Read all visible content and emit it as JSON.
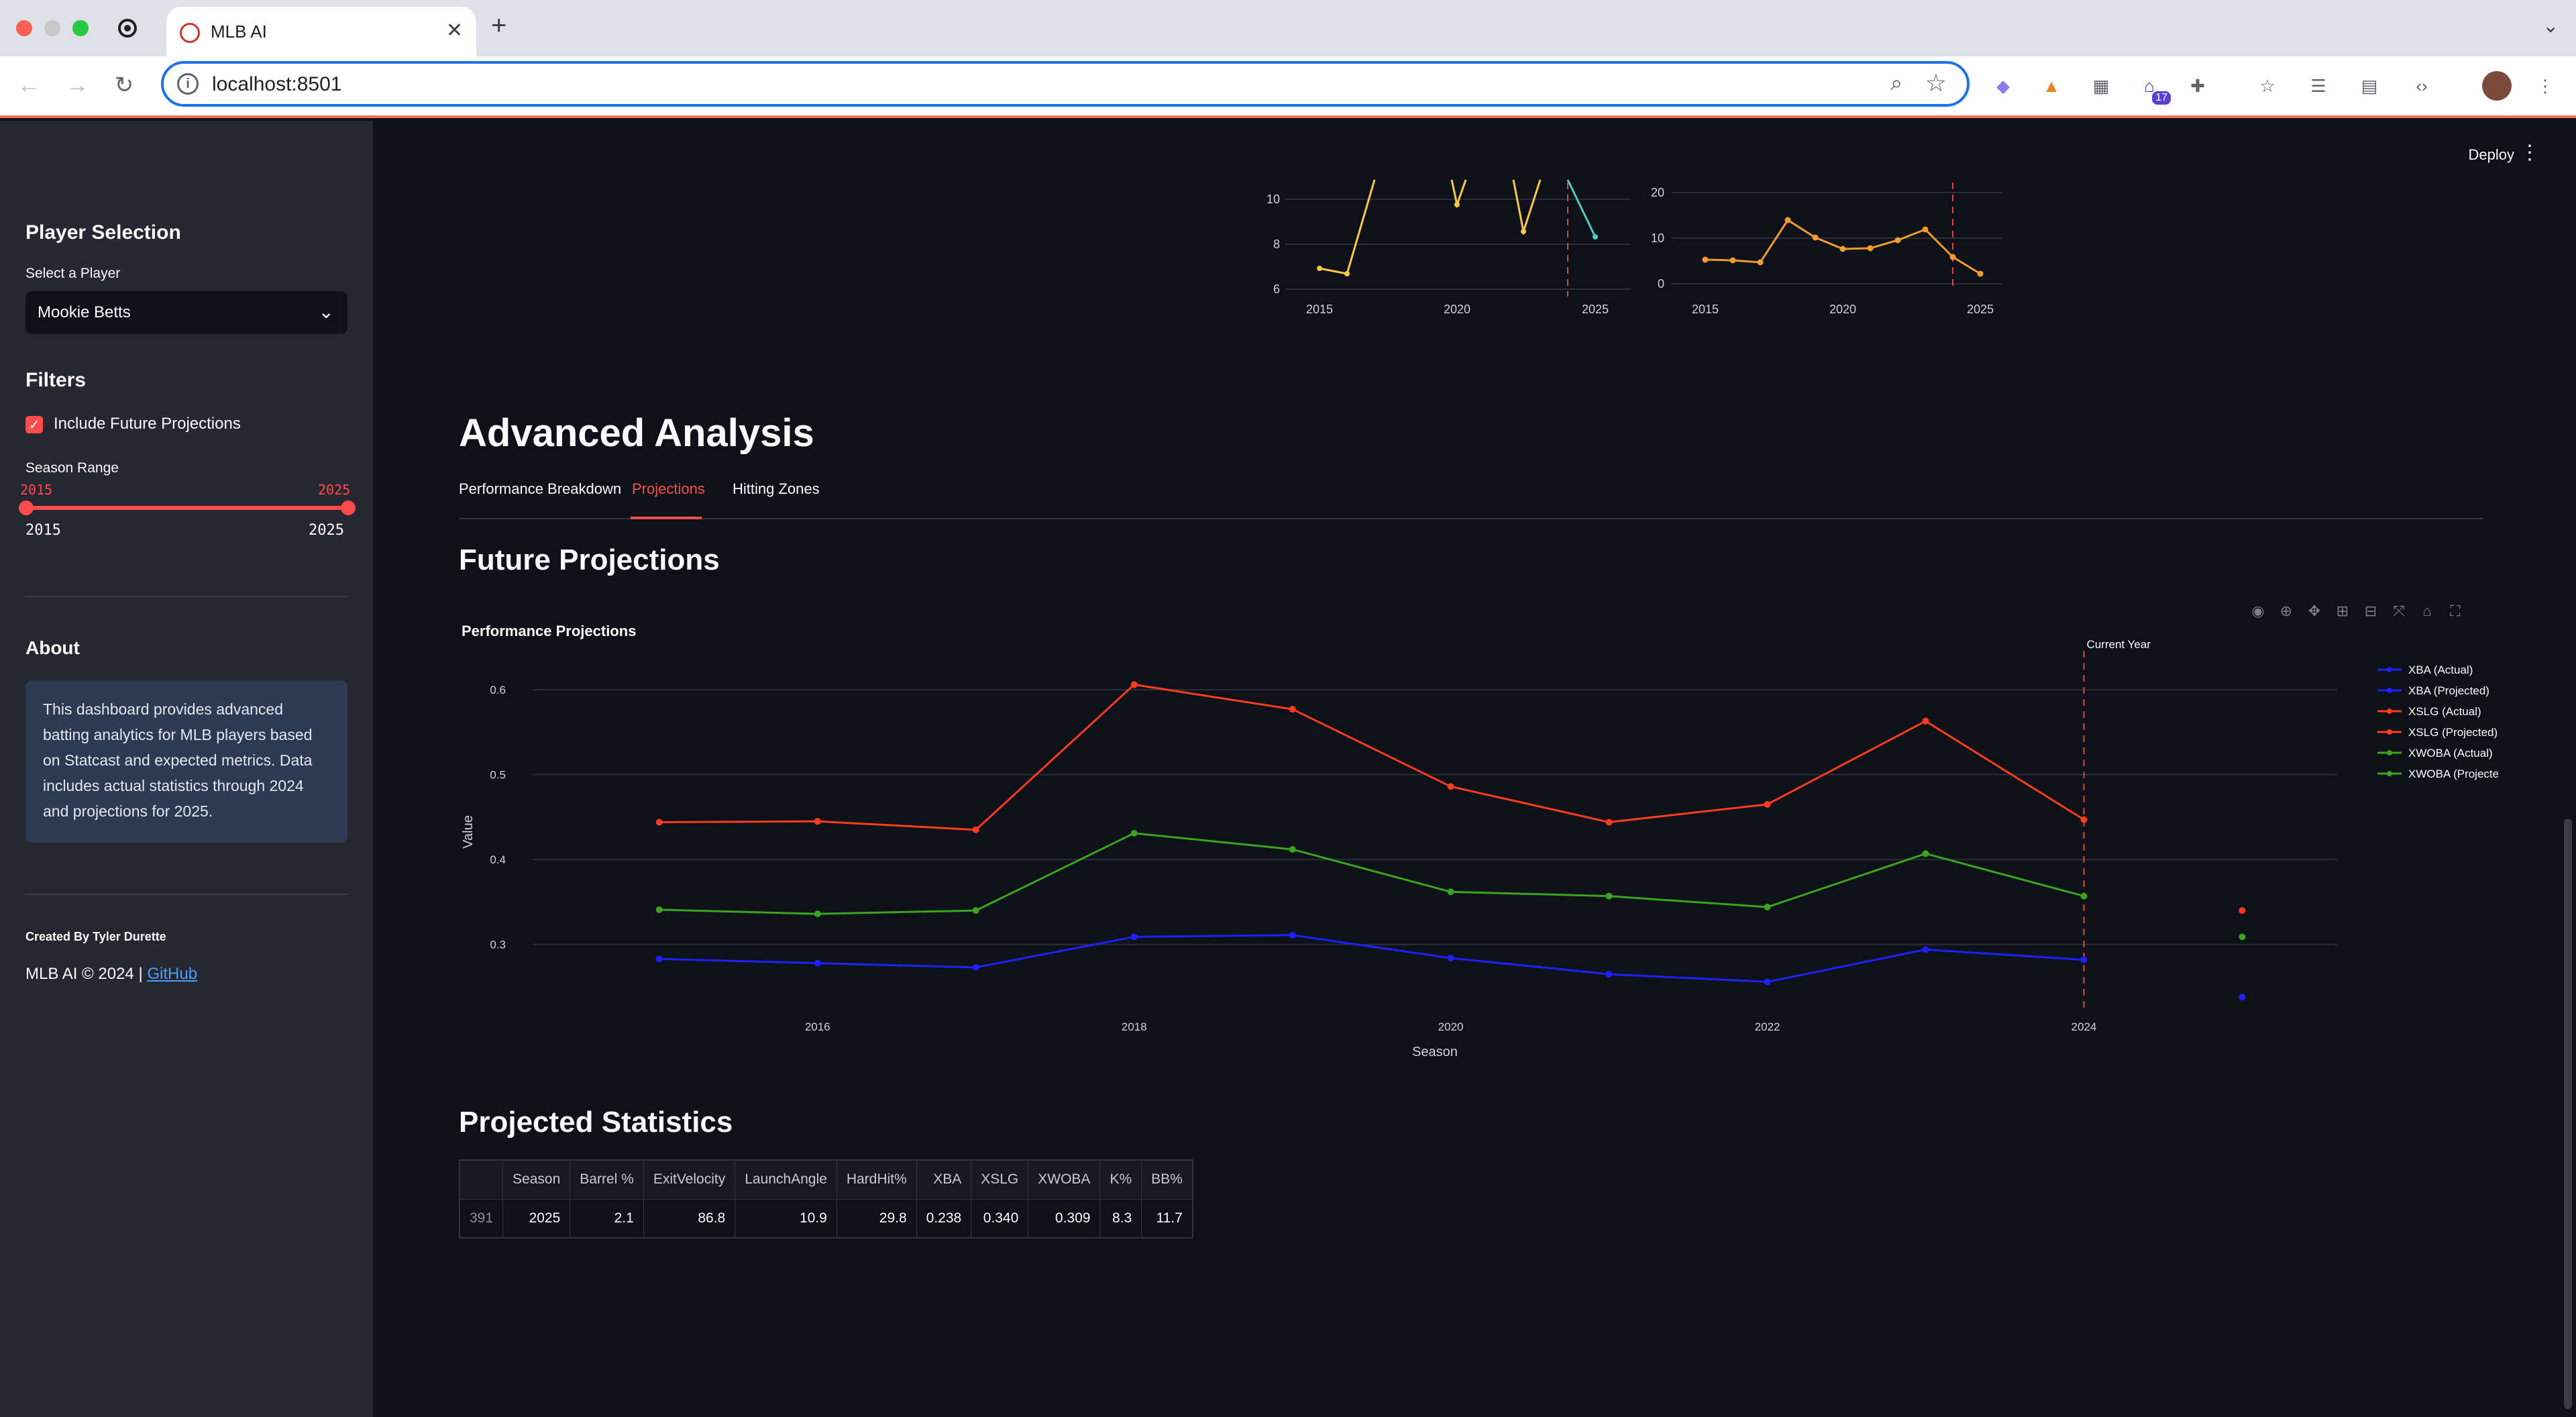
{
  "browser": {
    "tab_title": "MLB AI",
    "url": "localhost:8501",
    "extension_badge": "17"
  },
  "sidebar": {
    "player_heading": "Player Selection",
    "player_label": "Select a Player",
    "player_value": "Mookie Betts",
    "filters_heading": "Filters",
    "include_future_label": "Include Future Projections",
    "include_future_checked": true,
    "season_range_label": "Season Range",
    "slider_value_low": "2015",
    "slider_value_high": "2025",
    "slider_min": "2015",
    "slider_max": "2025",
    "about_heading": "About",
    "about_text": "This dashboard provides advanced batting analytics for MLB players based on Statcast and expected metrics. Data includes actual statistics through 2024 and projections for 2025.",
    "credit": "Created By Tyler Durette",
    "footer_text": "MLB AI © 2024 | ",
    "footer_link": "GitHub"
  },
  "header": {
    "deploy_label": "Deploy"
  },
  "mini_charts": {
    "left": {
      "x_ticks": [
        "2015",
        "2020",
        "2025"
      ],
      "y_ticks": [
        "6",
        "8",
        "10"
      ],
      "actual_color": "#f5c84a",
      "projection_color": "#4ecdc4"
    },
    "right": {
      "x_ticks": [
        "2015",
        "2020",
        "2025"
      ],
      "y_ticks": [
        "0",
        "10",
        "20"
      ],
      "color": "#f39c2e"
    }
  },
  "main": {
    "section_title": "Advanced Analysis",
    "tabs": [
      {
        "label": "Performance Breakdown",
        "active": false
      },
      {
        "label": "Projections",
        "active": true
      },
      {
        "label": "Hitting Zones",
        "active": false
      }
    ],
    "future_title": "Future Projections",
    "stats_title": "Projected Statistics"
  },
  "chart_data": {
    "type": "line",
    "title": "Performance Projections",
    "xlabel": "Season",
    "ylabel": "Value",
    "x": [
      2015,
      2016,
      2017,
      2018,
      2019,
      2020,
      2021,
      2022,
      2023,
      2024
    ],
    "x_ticks": [
      "2016",
      "2018",
      "2020",
      "2022",
      "2024"
    ],
    "y_ticks": [
      "0.3",
      "0.4",
      "0.5",
      "0.6"
    ],
    "xlim": [
      2014.2,
      2025.6
    ],
    "ylim": [
      0.235,
      0.63
    ],
    "grid": true,
    "legend_position": "right",
    "annotation": "Current Year",
    "current_year": 2024,
    "series": [
      {
        "name": "XBA (Actual)",
        "color": "#1f1fff",
        "values": [
          0.283,
          0.278,
          0.273,
          0.309,
          0.311,
          0.284,
          0.265,
          0.256,
          0.294,
          0.282
        ]
      },
      {
        "name": "XBA (Projected)",
        "color": "#1f1fff",
        "x": [
          2025
        ],
        "values": [
          0.238
        ]
      },
      {
        "name": "XSLG (Actual)",
        "color": "#ff3b1f",
        "values": [
          0.444,
          0.445,
          0.435,
          0.606,
          0.577,
          0.486,
          0.444,
          0.465,
          0.563,
          0.447
        ]
      },
      {
        "name": "XSLG (Projected)",
        "color": "#ff3b1f",
        "x": [
          2025
        ],
        "values": [
          0.34
        ]
      },
      {
        "name": "XWOBA (Actual)",
        "color": "#3aa31f",
        "values": [
          0.341,
          0.336,
          0.34,
          0.431,
          0.412,
          0.362,
          0.357,
          0.344,
          0.407,
          0.357
        ]
      },
      {
        "name": "XWOBA (Projected)",
        "color": "#3aa31f",
        "x": [
          2025
        ],
        "values": [
          0.309
        ]
      }
    ]
  },
  "stats_table": {
    "columns": [
      "",
      "Season",
      "Barrel %",
      "ExitVelocity",
      "LaunchAngle",
      "HardHit%",
      "XBA",
      "XSLG",
      "XWOBA",
      "K%",
      "BB%"
    ],
    "rows": [
      [
        "391",
        "2025",
        "2.1",
        "86.8",
        "10.9",
        "29.8",
        "0.238",
        "0.340",
        "0.309",
        "8.3",
        "11.7"
      ]
    ]
  }
}
